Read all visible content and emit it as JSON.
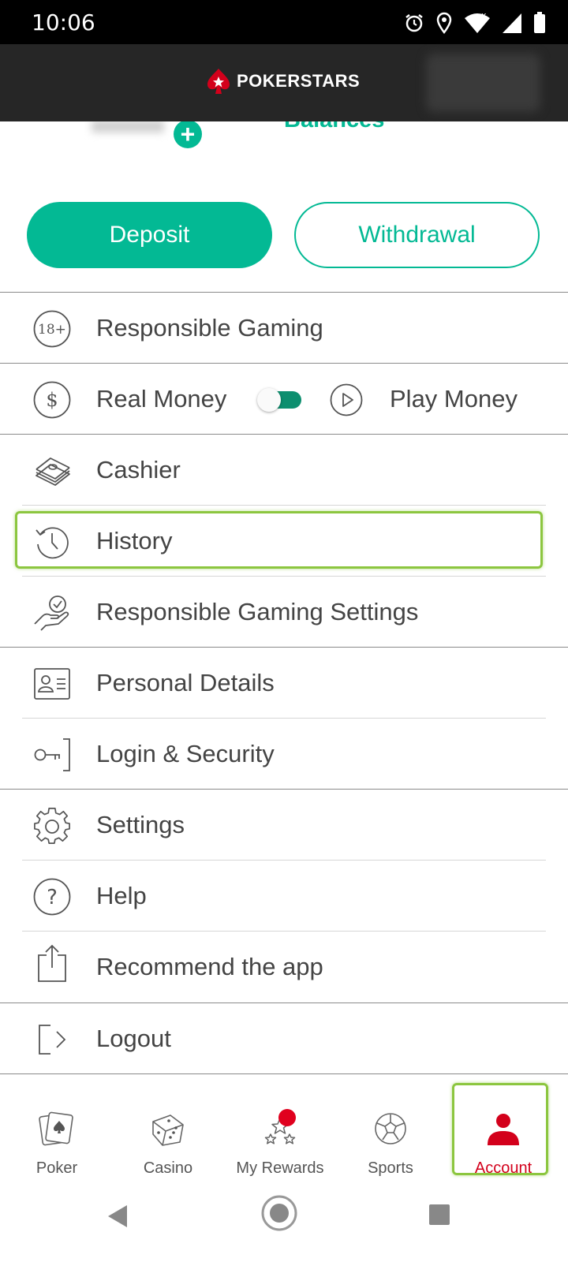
{
  "status_bar": {
    "time": "10:06"
  },
  "header": {
    "brand": "POKERSTARS"
  },
  "balances": {
    "label": "Balances"
  },
  "actions": {
    "deposit": "Deposit",
    "withdrawal": "Withdrawal"
  },
  "menu": {
    "responsible_gaming": "Responsible Gaming",
    "age_badge": "18+",
    "real_money": "Real Money",
    "play_money": "Play Money",
    "real_money_toggle_on": true,
    "cashier": "Cashier",
    "history": "History",
    "responsible_gaming_settings": "Responsible Gaming Settings",
    "personal_details": "Personal Details",
    "login_security": "Login & Security",
    "settings": "Settings",
    "help": "Help",
    "recommend": "Recommend the app",
    "logout": "Logout"
  },
  "bottom_nav": {
    "poker": "Poker",
    "casino": "Casino",
    "rewards": "My Rewards",
    "sports": "Sports",
    "account": "Account",
    "active": "account"
  },
  "colors": {
    "accent": "#03b994",
    "brand_red": "#d3001b",
    "header_bg": "#262626",
    "highlight": "#8cc63f"
  },
  "icons": {
    "status": [
      "alarm-icon",
      "location-icon",
      "wifi-icon",
      "signal-icon",
      "battery-icon"
    ],
    "menu": [
      "age-18-icon",
      "dollar-icon",
      "play-icon",
      "cash-stack-icon",
      "history-icon",
      "hand-check-icon",
      "id-card-icon",
      "key-icon",
      "gear-icon",
      "help-icon",
      "share-icon",
      "logout-icon"
    ],
    "nav": [
      "poker-cards-icon",
      "dice-icon",
      "rewards-stars-icon",
      "soccer-ball-icon",
      "person-icon"
    ]
  }
}
